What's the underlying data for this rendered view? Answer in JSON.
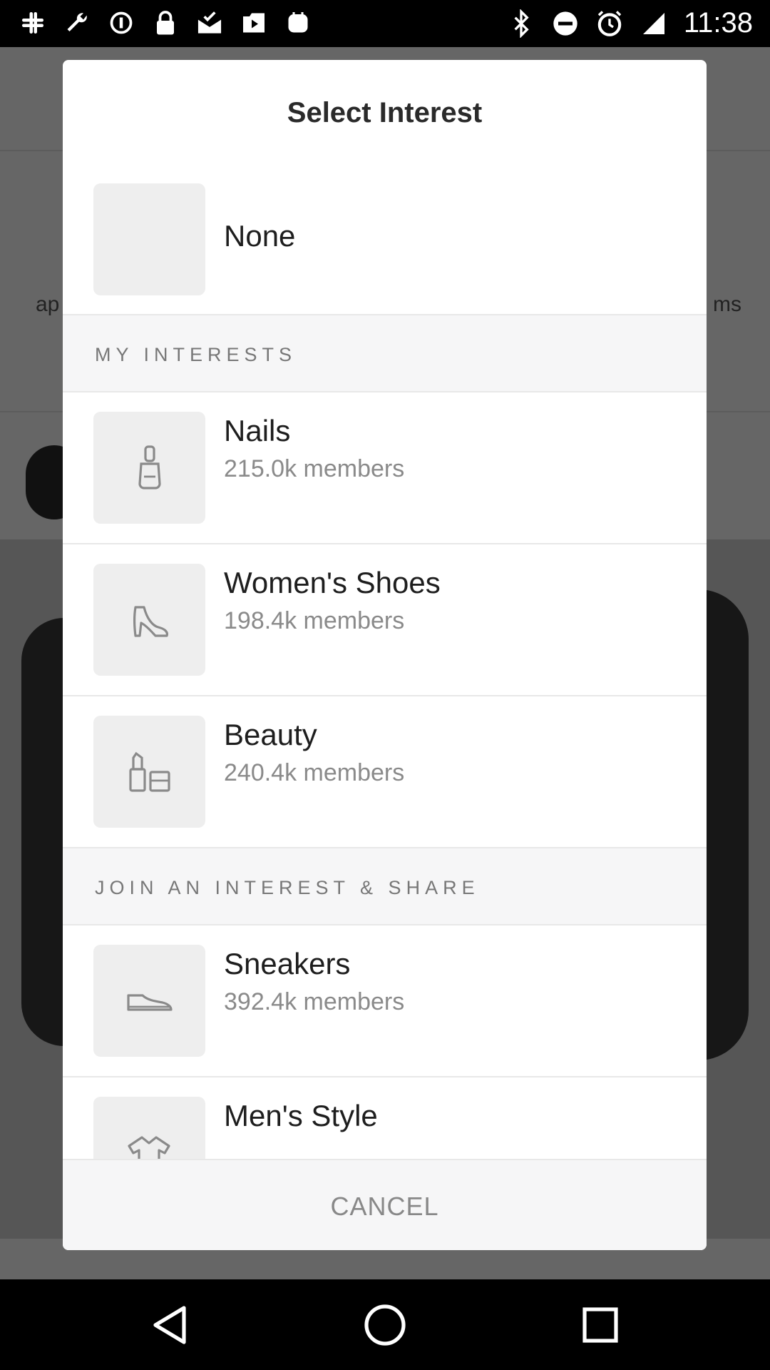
{
  "status_bar": {
    "time": "11:38",
    "left_icons": [
      "slack-icon",
      "wrench-icon",
      "ring-icon",
      "lock-icon",
      "mail-check-icon",
      "play-icon",
      "game-icon"
    ],
    "right_icons": [
      "bluetooth-icon",
      "do-not-disturb-icon",
      "alarm-icon",
      "signal-icon"
    ]
  },
  "background": {
    "left_fragment": "ap",
    "right_fragment": "ms"
  },
  "dialog": {
    "title": "Select Interest",
    "none_option": {
      "label": "None"
    },
    "sections": [
      {
        "header": "MY INTERESTS",
        "items": [
          {
            "title": "Nails",
            "members": "215.0k members",
            "icon": "nail-polish-icon"
          },
          {
            "title": "Women's Shoes",
            "members": "198.4k members",
            "icon": "high-heel-icon"
          },
          {
            "title": "Beauty",
            "members": "240.4k members",
            "icon": "lipstick-icon"
          }
        ]
      },
      {
        "header": "JOIN AN INTEREST & SHARE",
        "items": [
          {
            "title": "Sneakers",
            "members": "392.4k members",
            "icon": "sneaker-icon"
          },
          {
            "title": "Men's Style",
            "members": "",
            "icon": "shirt-icon"
          }
        ]
      }
    ],
    "cancel_label": "CANCEL"
  },
  "navigation": {
    "buttons": [
      "back-icon",
      "home-icon",
      "recents-icon"
    ]
  },
  "colors": {
    "dim_overlay": "rgba(0,0,0,0.6)",
    "section_bg": "#f6f6f7",
    "thumb_bg": "#eeeeee",
    "text_primary": "#1e1e1e",
    "text_secondary": "#8a8a8a"
  }
}
